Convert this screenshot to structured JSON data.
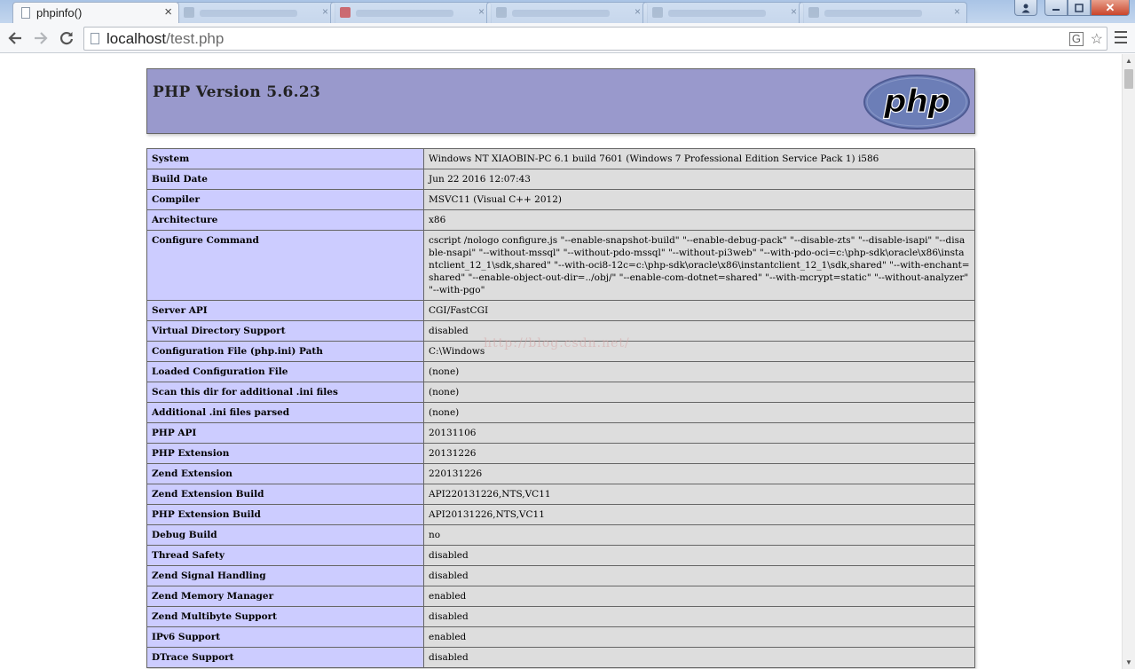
{
  "browser": {
    "active_tab": {
      "title": "phpinfo()"
    },
    "url": {
      "host": "localhost",
      "path": "/test.php"
    }
  },
  "page": {
    "header_title": "PHP Version 5.6.23",
    "watermark": "http://blog.csdn.net/",
    "rows": [
      {
        "name": "System",
        "value": "Windows NT XIAOBIN-PC 6.1 build 7601 (Windows 7 Professional Edition Service Pack 1) i586"
      },
      {
        "name": "Build Date",
        "value": "Jun 22 2016 12:07:43"
      },
      {
        "name": "Compiler",
        "value": "MSVC11 (Visual C++ 2012)"
      },
      {
        "name": "Architecture",
        "value": "x86"
      },
      {
        "name": "Configure Command",
        "value": "cscript /nologo configure.js \"--enable-snapshot-build\" \"--enable-debug-pack\" \"--disable-zts\" \"--disable-isapi\" \"--disable-nsapi\" \"--without-mssql\" \"--without-pdo-mssql\" \"--without-pi3web\" \"--with-pdo-oci=c:\\php-sdk\\oracle\\x86\\instantclient_12_1\\sdk,shared\" \"--with-oci8-12c=c:\\php-sdk\\oracle\\x86\\instantclient_12_1\\sdk,shared\" \"--with-enchant=shared\" \"--enable-object-out-dir=../obj/\" \"--enable-com-dotnet=shared\" \"--with-mcrypt=static\" \"--without-analyzer\" \"--with-pgo\""
      },
      {
        "name": "Server API",
        "value": "CGI/FastCGI"
      },
      {
        "name": "Virtual Directory Support",
        "value": "disabled"
      },
      {
        "name": "Configuration File (php.ini) Path",
        "value": "C:\\Windows"
      },
      {
        "name": "Loaded Configuration File",
        "value": "(none)"
      },
      {
        "name": "Scan this dir for additional .ini files",
        "value": "(none)"
      },
      {
        "name": "Additional .ini files parsed",
        "value": "(none)"
      },
      {
        "name": "PHP API",
        "value": "20131106"
      },
      {
        "name": "PHP Extension",
        "value": "20131226"
      },
      {
        "name": "Zend Extension",
        "value": "220131226"
      },
      {
        "name": "Zend Extension Build",
        "value": "API220131226,NTS,VC11"
      },
      {
        "name": "PHP Extension Build",
        "value": "API20131226,NTS,VC11"
      },
      {
        "name": "Debug Build",
        "value": "no"
      },
      {
        "name": "Thread Safety",
        "value": "disabled"
      },
      {
        "name": "Zend Signal Handling",
        "value": "disabled"
      },
      {
        "name": "Zend Memory Manager",
        "value": "enabled"
      },
      {
        "name": "Zend Multibyte Support",
        "value": "disabled"
      },
      {
        "name": "IPv6 Support",
        "value": "enabled"
      },
      {
        "name": "DTrace Support",
        "value": "disabled"
      }
    ]
  },
  "icons": {
    "back": "back-arrow-icon",
    "forward": "forward-arrow-icon",
    "reload": "reload-icon",
    "star": "bookmark-star-icon",
    "translate": "translate-icon",
    "menu": "hamburger-menu-icon",
    "logo": "php-logo-icon"
  },
  "colors": {
    "header_bg": "#9999cc",
    "label_bg": "#ccccff",
    "value_bg": "#dddddd",
    "border": "#666666"
  }
}
